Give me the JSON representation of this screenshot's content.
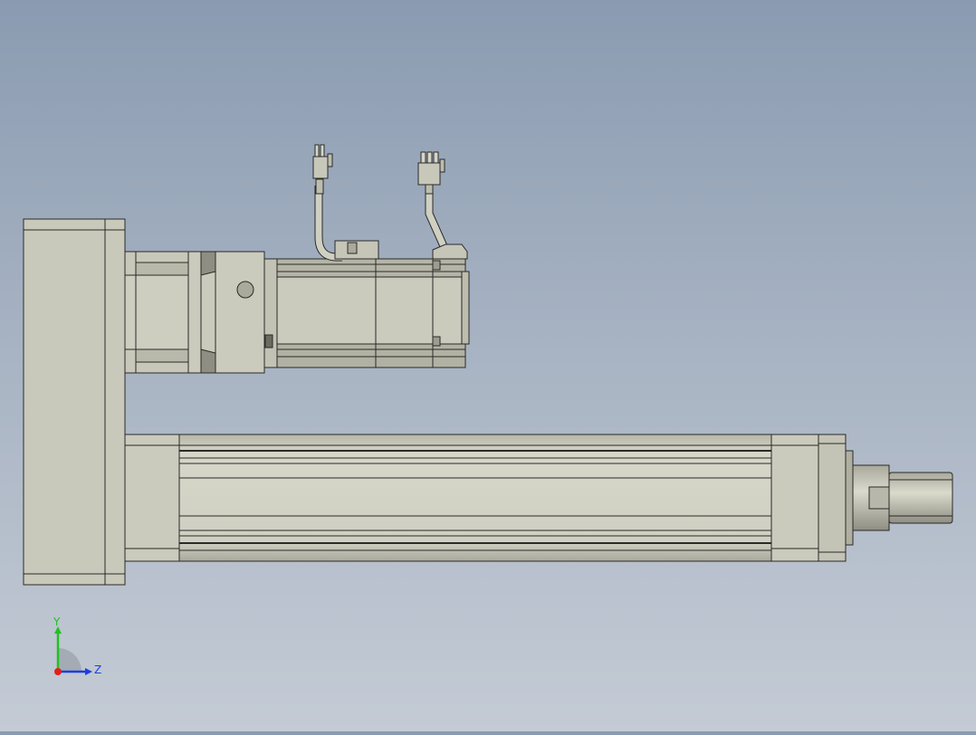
{
  "colors": {
    "background_top": "#8a9bb1",
    "background_bottom": "#c4cbd5",
    "part_fill": "#c8c8ba",
    "part_fill_dark": "#9d9d90",
    "part_fill_light": "#dcdccf",
    "edge": "#2a2a28",
    "axis_x": "#e0201a",
    "axis_y": "#1fc21f",
    "axis_z": "#1a3fe0"
  },
  "triad": {
    "y_label": "Y",
    "z_label": "Z"
  }
}
